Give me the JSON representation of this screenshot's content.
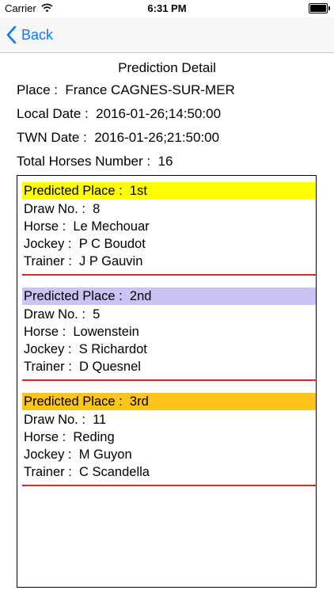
{
  "status_bar": {
    "carrier": "Carrier",
    "time": "6:31 PM",
    "icons": [
      "wifi-icon",
      "battery-icon"
    ]
  },
  "nav": {
    "back_label": "Back",
    "back_icon": "chevron-left-icon",
    "accent_color": "#0a7aff"
  },
  "detail": {
    "title": "Prediction Detail",
    "place": "Place :  France CAGNES-SUR-MER",
    "local_date": "Local Date :  2016-01-26;14:50:00",
    "twn_date": "TWN Date :  2016-01-26;21:50:00",
    "total_horses": "Total Horses Number :  16"
  },
  "predictions": [
    {
      "place": "Predicted Place :  1st",
      "color": "#ffff00",
      "draw": "Draw No. :  8",
      "horse": "Horse :  Le Mechouar",
      "jockey": "Jockey :  P C Boudot",
      "trainer": "Trainer :  J P Gauvin"
    },
    {
      "place": "Predicted Place :  2nd",
      "color": "#c9c4f4",
      "draw": "Draw No. :  5",
      "horse": "Horse :  Lowenstein",
      "jockey": "Jockey :  S Richardot",
      "trainer": "Trainer :  D Quesnel"
    },
    {
      "place": "Predicted Place :  3rd",
      "color": "#fdc41b",
      "draw": "Draw No. :  11",
      "horse": "Horse :  Reding",
      "jockey": "Jockey :  M Guyon",
      "trainer": "Trainer :  C Scandella"
    }
  ],
  "separator_color": "#d12c2c"
}
